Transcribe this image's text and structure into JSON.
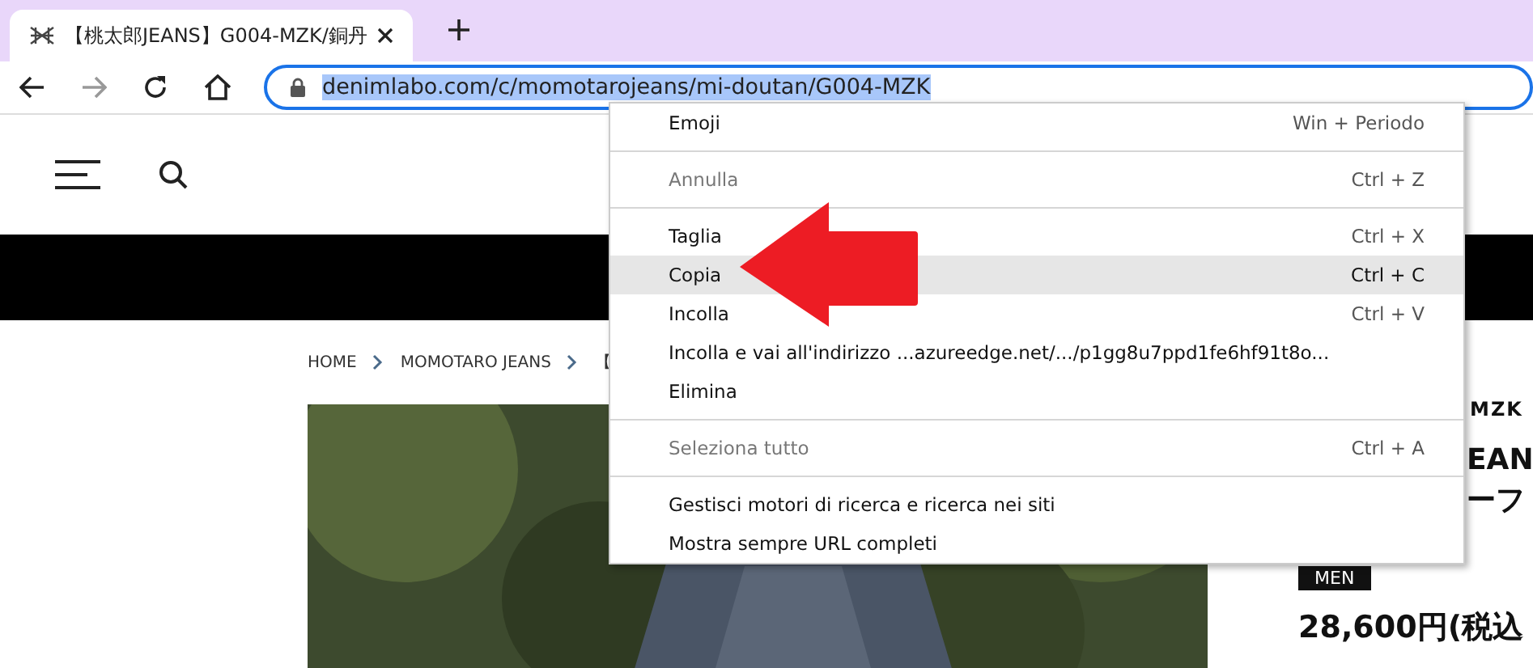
{
  "browser": {
    "tab": {
      "title": "【桃太郎JEANS】G004-MZK/銅丹"
    },
    "address": {
      "url": "denimlabo.com/c/momotarojeans/mi-doutan/G004-MZK",
      "selected_text": true
    }
  },
  "page": {
    "breadcrumb": [
      "HOME",
      "MOMOTARO JEANS",
      "【"
    ],
    "product": {
      "code": "MZK",
      "title_lines": [
        "EAN",
        "ーフ"
      ],
      "tag": "MEN",
      "price": "28,600円(税込"
    }
  },
  "context_menu": {
    "items": [
      {
        "kind": "item",
        "label": "Emoji",
        "shortcut": "Win + Periodo",
        "disabled": false,
        "selected": false
      },
      {
        "kind": "separator"
      },
      {
        "kind": "item",
        "label": "Annulla",
        "shortcut": "Ctrl + Z",
        "disabled": true,
        "selected": false
      },
      {
        "kind": "separator"
      },
      {
        "kind": "item",
        "label": "Taglia",
        "shortcut": "Ctrl + X",
        "disabled": false,
        "selected": false
      },
      {
        "kind": "item",
        "label": "Copia",
        "shortcut": "Ctrl + C",
        "disabled": false,
        "selected": true
      },
      {
        "kind": "item",
        "label": "Incolla",
        "shortcut": "Ctrl + V",
        "disabled": false,
        "selected": false
      },
      {
        "kind": "item",
        "label": "Incolla e vai all'indirizzo ...azureedge.net/.../p1gg8u7ppd1fe6hf91t8o...",
        "disabled": false,
        "selected": false
      },
      {
        "kind": "item",
        "label": "Elimina",
        "disabled": false,
        "selected": false
      },
      {
        "kind": "separator"
      },
      {
        "kind": "item",
        "label": "Seleziona tutto",
        "shortcut": "Ctrl + A",
        "disabled": true,
        "selected": false
      },
      {
        "kind": "separator"
      },
      {
        "kind": "item",
        "label": "Gestisci motori di ricerca e ricerca nei siti",
        "disabled": false,
        "selected": false
      },
      {
        "kind": "item",
        "label": "Mostra sempre URL completi",
        "disabled": false,
        "selected": false
      }
    ]
  }
}
